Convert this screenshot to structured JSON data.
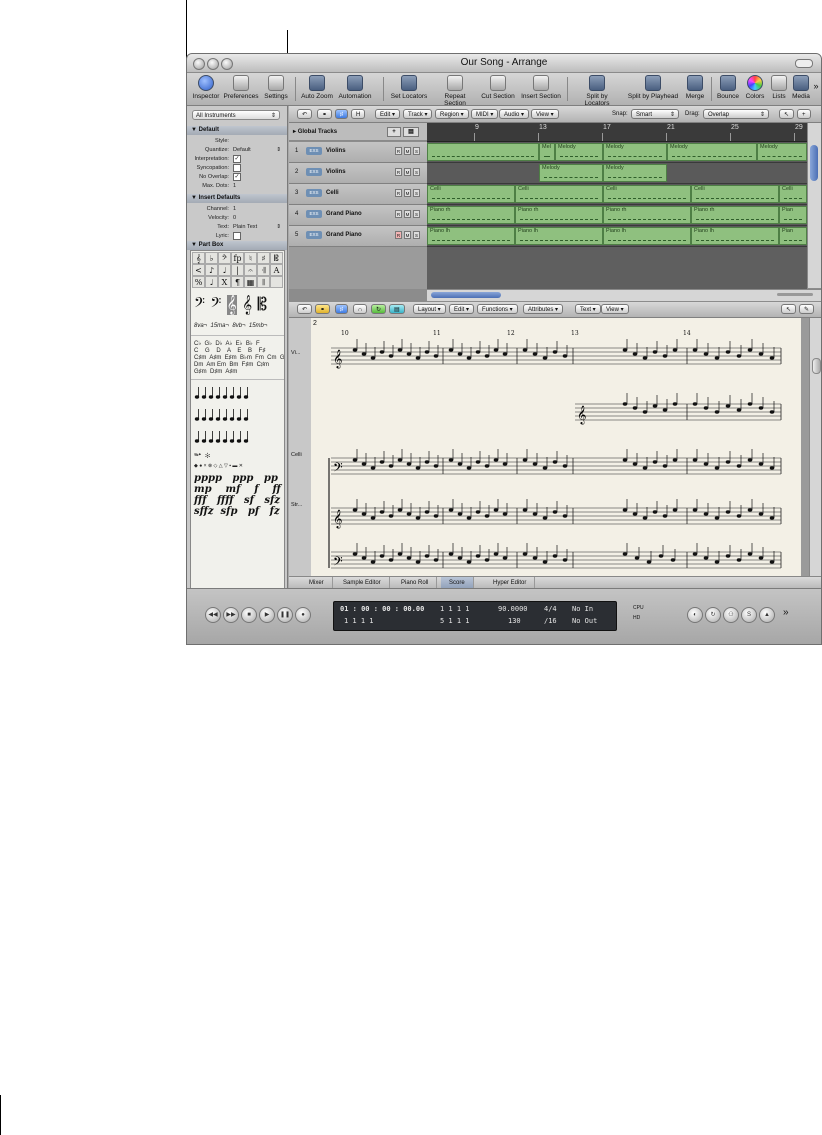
{
  "window": {
    "title": "Our Song - Arrange"
  },
  "toolbar": {
    "buttons": [
      "Inspector",
      "Preferences",
      "Settings",
      "Auto Zoom",
      "Automation",
      "Set Locators",
      "Repeat Section",
      "Cut Section",
      "Insert Section",
      "Split by Locators",
      "Split by Playhead",
      "Merge",
      "Bounce",
      "Colors",
      "Lists",
      "Media"
    ],
    "more": "»"
  },
  "inspector": {
    "dropdown": "All Instruments",
    "default_header": "Default",
    "default_rows": [
      {
        "label": "Style:",
        "value": ""
      },
      {
        "label": "Quantize:",
        "value": "Default"
      },
      {
        "label": "Interpretation:",
        "value": "✓"
      },
      {
        "label": "Syncopation:",
        "value": ""
      },
      {
        "label": "No Overlap:",
        "value": "✓"
      },
      {
        "label": "Max. Dots:",
        "value": "1"
      }
    ],
    "insert_header": "Insert Defaults",
    "insert_rows": [
      {
        "label": "Channel:",
        "value": "1"
      },
      {
        "label": "Velocity:",
        "value": "0"
      },
      {
        "label": "Text:",
        "value": "Plain Text"
      },
      {
        "label": "Lyric:",
        "value": ""
      }
    ],
    "partbox_header": "Part Box",
    "partbox_symbols": [
      "𝄞",
      "♭",
      "𝄢",
      "fp",
      "♮",
      "♯",
      "𝄡",
      "<",
      "♪",
      "♩",
      "|",
      "𝄐",
      "𝄇",
      "A",
      "%",
      "♩",
      "X",
      "¶",
      "▦",
      "𝄂"
    ],
    "partbox_lines": {
      "octave": "8va¬  15ma¬  8vb¬  15mb¬",
      "chords": "C♭  G♭  D♭  A♭  E♭  B♭  F\nC    G    D    A    E    B    F♯\nC♯m  A♯m  E♯m  B♭m  Fm  Cm  Gm\nDm  Am Em  Bm  F♯m  C♯m\nG♯m  D♯m  A♯m",
      "pedal": "𝆮𝆯  ✻",
      "heads": "◆ ● × ⊗ ◇ △ ▽ ▪ ▬ ✕",
      "dynamics": "pppp   ppp   pp    p\nmp    mf    f    ff\nfff   ffff   sf   sfz\nsffz  sfp   pf   fz"
    }
  },
  "arrange": {
    "menus": [
      "Edit",
      "Track",
      "Region",
      "MIDI",
      "Audio",
      "View"
    ],
    "snap_label": "Snap:",
    "snap_value": "Smart",
    "drag_label": "Drag:",
    "drag_value": "Overlap",
    "global_tracks": "Global Tracks",
    "ruler": [
      "9",
      "13",
      "17",
      "21",
      "25",
      "29"
    ],
    "tracks": [
      {
        "num": "1",
        "name": "Violins",
        "plugin": "EXS"
      },
      {
        "num": "2",
        "name": "Violins",
        "plugin": "EXS"
      },
      {
        "num": "3",
        "name": "Celli",
        "plugin": "EXS"
      },
      {
        "num": "4",
        "name": "Grand Piano",
        "plugin": "EXS"
      },
      {
        "num": "5",
        "name": "Grand Piano",
        "plugin": "EXS"
      }
    ],
    "region_labels": {
      "melody": "Melody",
      "melody_short": "Mel",
      "celli": "Celli",
      "piano_rh": "Piano rh",
      "piano_lh": "Piano lh",
      "piano_short": "Pian"
    },
    "track_buttons": [
      "R",
      "M",
      "S"
    ]
  },
  "score": {
    "menus": [
      "Layout",
      "Edit",
      "Functions",
      "Attributes",
      "Text",
      "View"
    ],
    "staff_names": [
      "Vi...",
      "Celli",
      "Str..."
    ],
    "page_num": "2",
    "bar_nums": [
      "10",
      "11",
      "12",
      "13",
      "14"
    ]
  },
  "tabs": [
    "Mixer",
    "Sample Editor",
    "Piano Roll",
    "Score",
    "Hyper Editor"
  ],
  "transport": {
    "smpte": "01 : 00 : 00 : 00.00",
    "pos1": "1   1   1   1",
    "pos2": "1   1   1   1",
    "pos3": "5   1   1   1",
    "tempo": "90.0000",
    "division": "130",
    "sig": "4/4",
    "div2": "/16",
    "midi_in": "No In",
    "midi_out": "No Out",
    "cpu": "CPU",
    "hd": "HD"
  }
}
